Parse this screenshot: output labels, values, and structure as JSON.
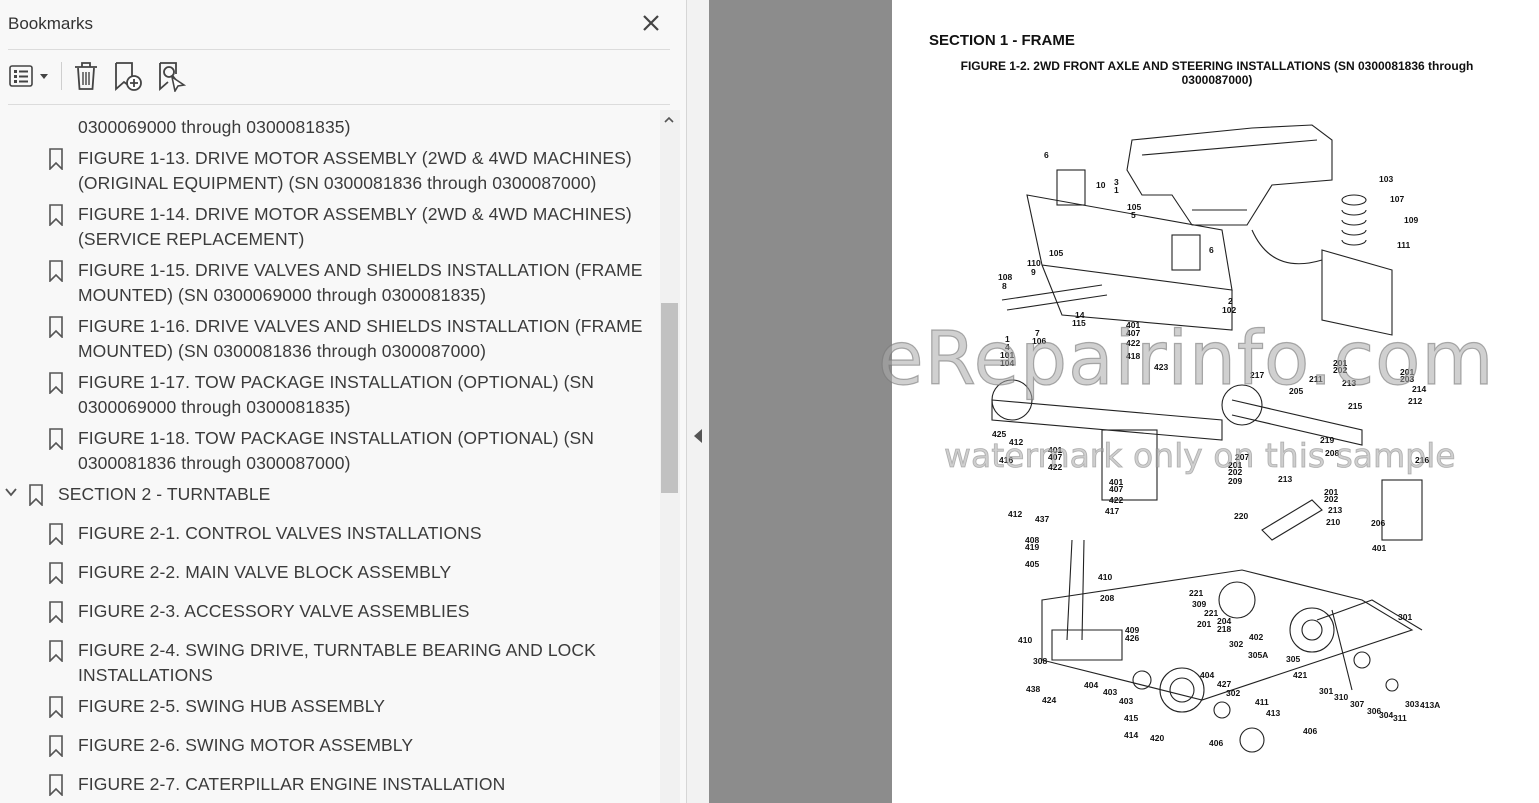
{
  "panel": {
    "title": "Bookmarks"
  },
  "bookmarks": [
    {
      "line1": "0300069000 through 0300081835)",
      "line2": ""
    },
    {
      "line1": "FIGURE 1-13. DRIVE MOTOR ASSEMBLY (2WD & 4WD MACHINES)",
      "line2": "(ORIGINAL EQUIPMENT) (SN 0300081836 through 0300087000)"
    },
    {
      "line1": "FIGURE 1-14. DRIVE MOTOR ASSEMBLY (2WD & 4WD MACHINES)",
      "line2": "(SERVICE REPLACEMENT)"
    },
    {
      "line1": "FIGURE 1-15. DRIVE VALVES AND SHIELDS INSTALLATION (FRAME",
      "line2": "MOUNTED) (SN 0300069000 through 0300081835)"
    },
    {
      "line1": "FIGURE 1-16. DRIVE VALVES AND SHIELDS INSTALLATION (FRAME",
      "line2": "MOUNTED) (SN 0300081836 through 0300087000)"
    },
    {
      "line1": "FIGURE 1-17. TOW PACKAGE INSTALLATION (OPTIONAL) (SN",
      "line2": "0300069000 through 0300081835)"
    },
    {
      "line1": "FIGURE 1-18. TOW PACKAGE INSTALLATION (OPTIONAL) (SN",
      "line2": "0300081836 through 0300087000)"
    },
    {
      "line1": "SECTION 2 - TURNTABLE",
      "line2": ""
    },
    {
      "line1": "FIGURE 2-1. CONTROL VALVES INSTALLATIONS",
      "line2": ""
    },
    {
      "line1": "FIGURE 2-2. MAIN VALVE BLOCK ASSEMBLY",
      "line2": ""
    },
    {
      "line1": "FIGURE 2-3. ACCESSORY VALVE ASSEMBLIES",
      "line2": ""
    },
    {
      "line1": "FIGURE 2-4. SWING DRIVE, TURNTABLE BEARING AND LOCK",
      "line2": "INSTALLATIONS"
    },
    {
      "line1": "FIGURE 2-5. SWING HUB ASSEMBLY",
      "line2": ""
    },
    {
      "line1": "FIGURE 2-6. SWING MOTOR ASSEMBLY",
      "line2": ""
    },
    {
      "line1": "FIGURE 2-7. CATERPILLAR ENGINE INSTALLATION",
      "line2": ""
    }
  ],
  "document": {
    "section_title": "SECTION 1 - FRAME",
    "figure_title_line1": "FIGURE 1-2. 2WD FRONT AXLE AND STEERING INSTALLATIONS (SN 0300081836 through",
    "figure_title_line2": "0300087000)",
    "watermark_main": "eRepairinfo.com",
    "watermark_sub": "watermark only on this sample",
    "part_labels": [
      "6",
      "3",
      "1",
      "10",
      "105",
      "5",
      "103",
      "107",
      "109",
      "111",
      "6",
      "105",
      "110",
      "9",
      "108",
      "8",
      "2",
      "102",
      "14",
      "115",
      "7",
      "106",
      "1",
      "4",
      "101",
      "104",
      "401",
      "407",
      "422",
      "418",
      "423",
      "201",
      "202",
      "213",
      "211",
      "217",
      "205",
      "215",
      "201",
      "203",
      "214",
      "212",
      "425",
      "412",
      "416",
      "401",
      "407",
      "422",
      "219",
      "208",
      "216",
      "207",
      "201",
      "202",
      "209",
      "213",
      "401",
      "407",
      "422",
      "417",
      "412",
      "437",
      "201",
      "202",
      "213",
      "210",
      "206",
      "220",
      "401",
      "408",
      "419",
      "405",
      "410",
      "208",
      "221",
      "309",
      "221",
      "201",
      "204",
      "218",
      "301",
      "402",
      "409",
      "426",
      "410",
      "308",
      "302",
      "305A",
      "305",
      "421",
      "438",
      "424",
      "404",
      "403",
      "403",
      "404",
      "427",
      "302",
      "301",
      "310",
      "307",
      "306",
      "304",
      "311",
      "303",
      "413A",
      "415",
      "411",
      "413",
      "414",
      "420",
      "406"
    ]
  }
}
